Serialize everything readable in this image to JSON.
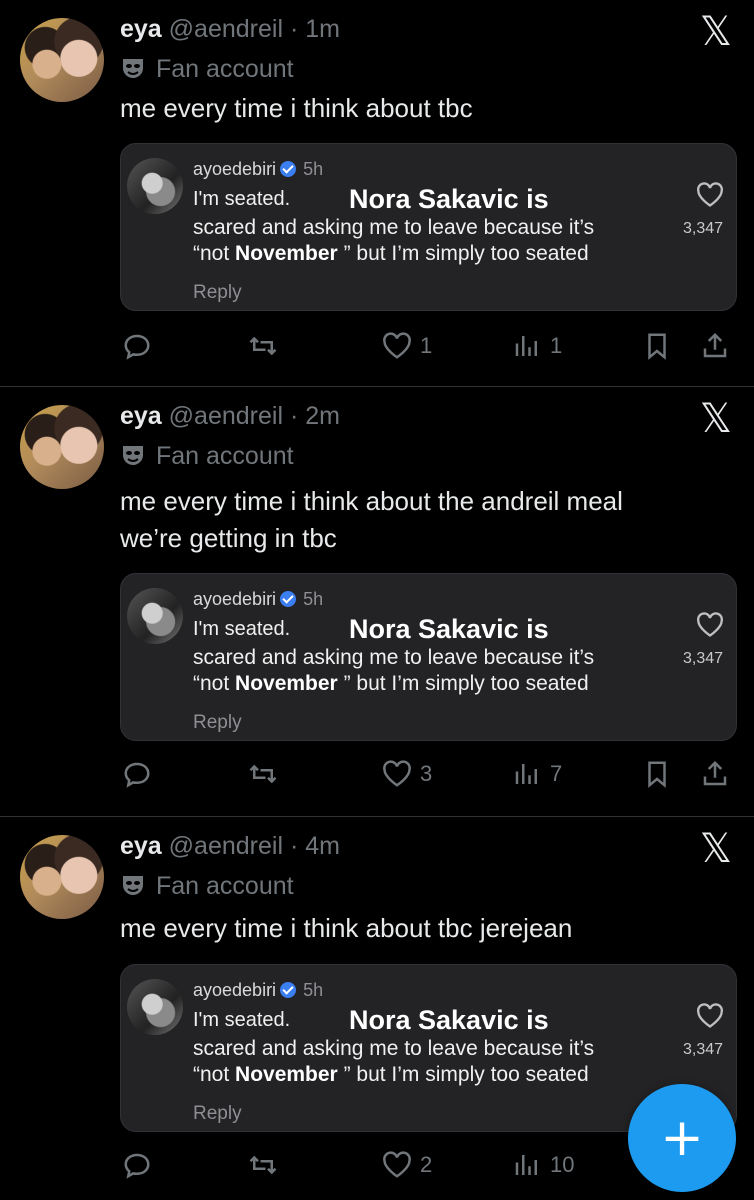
{
  "tweets": [
    {
      "name": "eya",
      "handle": "@aendreil",
      "sep": " · ",
      "time": "1m",
      "label": "Fan account",
      "text": "me every time i think about tbc",
      "embed": {
        "user": "ayoedebiri",
        "time": "5h",
        "line1": "I'm seated.",
        "big": "Nora Sakavic is",
        "line2": "scared and asking me to leave because it’s",
        "line3_pre": "“not ",
        "line3_bold": "November",
        "line3_post": " ” but I’m simply too seated",
        "reply": "Reply",
        "likes": "3,347"
      },
      "stats": {
        "replies": "",
        "retweets": "",
        "likes": "1",
        "views": "1"
      }
    },
    {
      "name": "eya",
      "handle": "@aendreil",
      "sep": " · ",
      "time": "2m",
      "label": "Fan account",
      "text_line1": "me every time i think about the andreil meal",
      "text_line2": "we’re getting in tbc",
      "embed": {
        "user": "ayoedebiri",
        "time": "5h",
        "line1": "I'm seated.",
        "big": "Nora Sakavic is",
        "line2": "scared and asking me to leave because it’s",
        "line3_pre": "“not ",
        "line3_bold": "November",
        "line3_post": " ” but I’m simply too seated",
        "reply": "Reply",
        "likes": "3,347"
      },
      "stats": {
        "replies": "",
        "retweets": "",
        "likes": "3",
        "views": "7"
      }
    },
    {
      "name": "eya",
      "handle": "@aendreil",
      "sep": " · ",
      "time": "4m",
      "label": "Fan account",
      "text": "me every time i think about tbc jerejean",
      "embed": {
        "user": "ayoedebiri",
        "time": "5h",
        "line1": "I'm seated.",
        "big": "Nora Sakavic is",
        "line2": "scared and asking me to leave because it’s",
        "line3_pre": "“not ",
        "line3_bold": "November",
        "line3_post": " ” but I’m simply too seated",
        "reply": "Reply",
        "likes": "3,347"
      },
      "stats": {
        "replies": "",
        "retweets": "",
        "likes": "2",
        "views": "10"
      }
    }
  ],
  "x_logo": "𝕏",
  "fab_label": "+",
  "colors": {
    "background": "#000000",
    "muted": "#71767b",
    "accent": "#1d9bf0",
    "verified": "#3b7ef0"
  }
}
